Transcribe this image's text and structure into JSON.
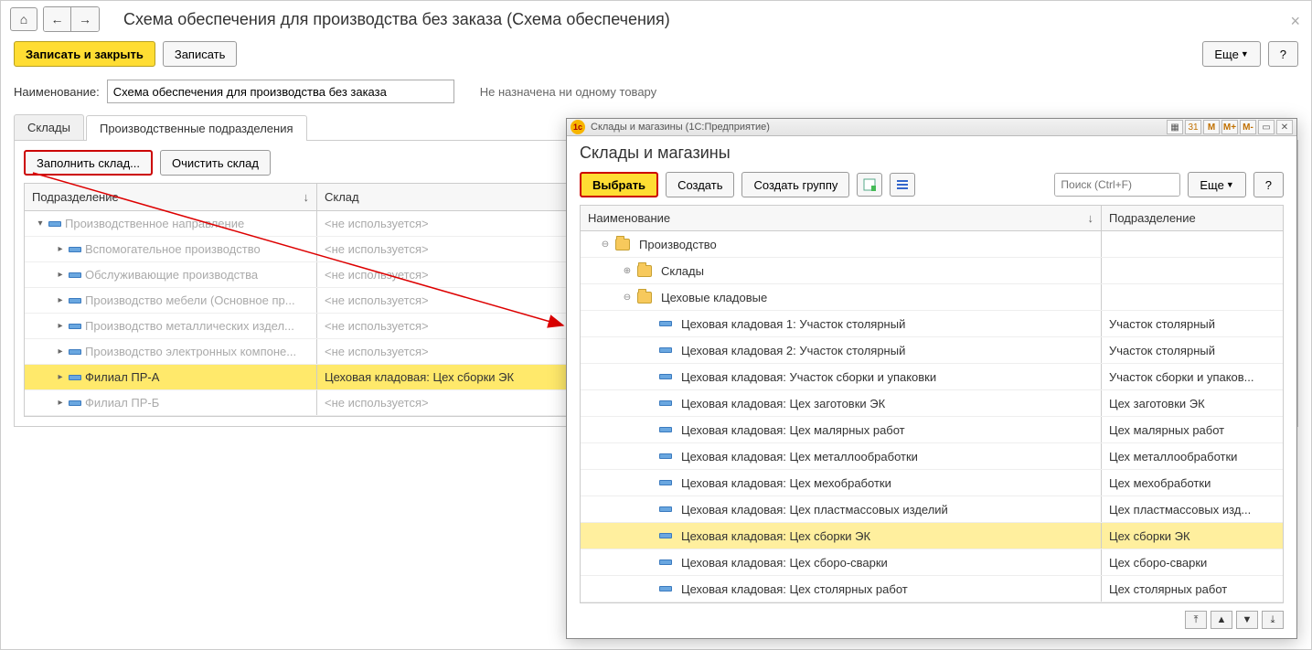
{
  "nav": {
    "home": "⌂",
    "back": "←",
    "fwd": "→"
  },
  "pageTitle": "Схема обеспечения для производства без заказа (Схема обеспечения)",
  "toolbar": {
    "writeClose": "Записать и закрыть",
    "write": "Записать",
    "more": "Еще",
    "help": "?"
  },
  "form": {
    "nameLabel": "Наименование:",
    "nameValue": "Схема обеспечения для производства без заказа",
    "notAssigned": "Не назначена ни одному товару"
  },
  "tabs": {
    "warehouses": "Склады",
    "units": "Производственные подразделения"
  },
  "tabToolbar": {
    "fill": "Заполнить склад...",
    "clear": "Очистить склад"
  },
  "gridHeader": {
    "dept": "Подразделение",
    "wh": "Склад",
    "sort": "↓"
  },
  "rows": [
    {
      "level": 0,
      "toggle": "expanded",
      "name": "Производственное направление",
      "wh": "<не используется>",
      "grey": true
    },
    {
      "level": 1,
      "toggle": "collapsed",
      "name": "Вспомогательное производство",
      "wh": "<не используется>",
      "grey": true
    },
    {
      "level": 1,
      "toggle": "collapsed",
      "name": "Обслуживающие производства",
      "wh": "<не используется>",
      "grey": true
    },
    {
      "level": 1,
      "toggle": "collapsed",
      "name": "Производство мебели (Основное пр...",
      "wh": "<не используется>",
      "grey": true
    },
    {
      "level": 1,
      "toggle": "collapsed",
      "name": "Производство металлических издел...",
      "wh": "<не используется>",
      "grey": true
    },
    {
      "level": 1,
      "toggle": "collapsed",
      "name": "Производство электронных компоне...",
      "wh": "<не используется>",
      "grey": true
    },
    {
      "level": 1,
      "toggle": "collapsed",
      "name": "Филиал ПР-А",
      "wh": "Цеховая кладовая: Цех сборки ЭК",
      "sel": true
    },
    {
      "level": 1,
      "toggle": "collapsed",
      "name": "Филиал ПР-Б",
      "wh": "<не используется>",
      "grey": true
    }
  ],
  "modal": {
    "titlebar": "Склады и магазины  (1С:Предприятие)",
    "title": "Склады и магазины",
    "toolbar": {
      "select": "Выбрать",
      "create": "Создать",
      "createGroup": "Создать группу",
      "searchPlaceholder": "Поиск (Ctrl+F)",
      "more": "Еще",
      "help": "?"
    },
    "gridHeader": {
      "name": "Наименование",
      "dept": "Подразделение",
      "sort": "↓"
    },
    "rows": [
      {
        "level": 0,
        "type": "folder",
        "toggle": "minus",
        "name": "Производство",
        "dept": ""
      },
      {
        "level": 1,
        "type": "folder",
        "toggle": "plus",
        "name": "Склады",
        "dept": ""
      },
      {
        "level": 1,
        "type": "folder",
        "toggle": "minus",
        "name": "Цеховые кладовые",
        "dept": ""
      },
      {
        "level": 2,
        "type": "item",
        "name": "Цеховая кладовая 1: Участок столярный",
        "dept": "Участок столярный"
      },
      {
        "level": 2,
        "type": "item",
        "name": "Цеховая кладовая 2: Участок столярный",
        "dept": "Участок столярный"
      },
      {
        "level": 2,
        "type": "item",
        "name": "Цеховая кладовая: Участок сборки и упаковки",
        "dept": "Участок сборки и упаков..."
      },
      {
        "level": 2,
        "type": "item",
        "name": "Цеховая кладовая: Цех заготовки ЭК",
        "dept": "Цех заготовки ЭК"
      },
      {
        "level": 2,
        "type": "item",
        "name": "Цеховая кладовая: Цех малярных работ",
        "dept": "Цех малярных работ"
      },
      {
        "level": 2,
        "type": "item",
        "name": "Цеховая кладовая: Цех металлообработки",
        "dept": "Цех металлообработки"
      },
      {
        "level": 2,
        "type": "item",
        "name": "Цеховая кладовая: Цех мехобработки",
        "dept": "Цех мехобработки"
      },
      {
        "level": 2,
        "type": "item",
        "name": "Цеховая кладовая: Цех пластмассовых изделий",
        "dept": "Цех пластмассовых изд..."
      },
      {
        "level": 2,
        "type": "item",
        "name": "Цеховая кладовая: Цех сборки ЭК",
        "dept": "Цех сборки ЭК",
        "sel": true
      },
      {
        "level": 2,
        "type": "item",
        "name": "Цеховая кладовая: Цех сборо-сварки",
        "dept": "Цех сборо-сварки"
      },
      {
        "level": 2,
        "type": "item",
        "name": "Цеховая кладовая: Цех столярных работ",
        "dept": "Цех столярных работ"
      }
    ],
    "footerBtns": [
      "⤒",
      "▲",
      "▼",
      "⤓"
    ]
  }
}
